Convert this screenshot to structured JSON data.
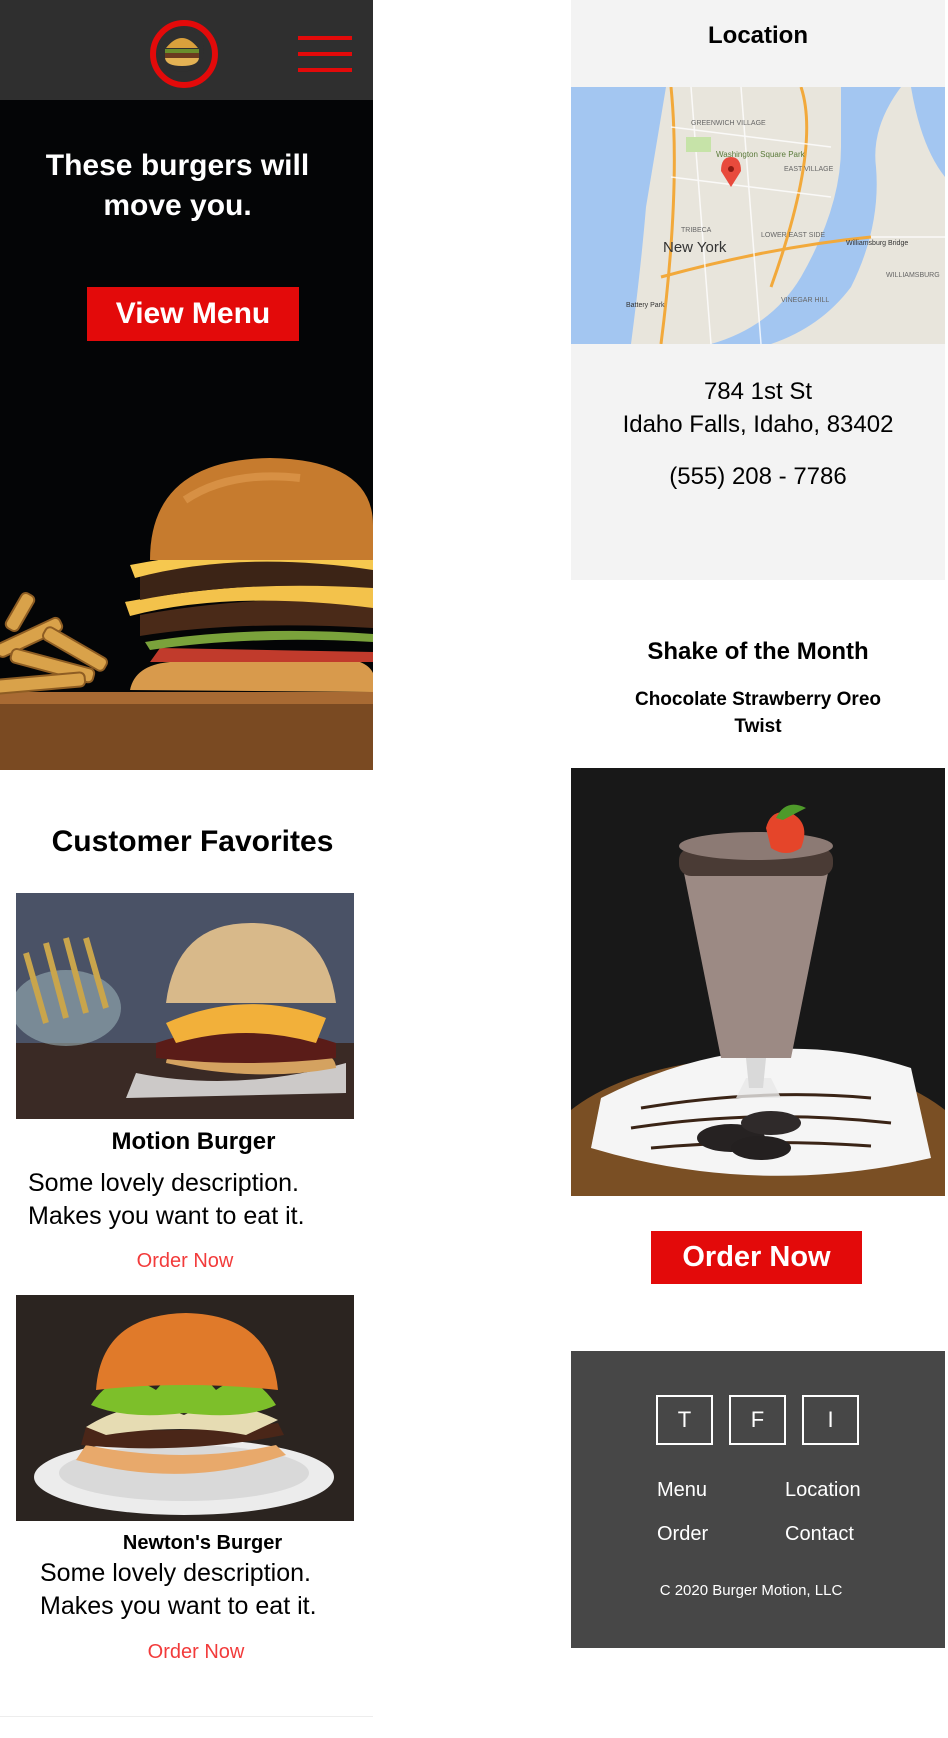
{
  "header": {
    "logo_icon": "burger-logo-icon",
    "menu_icon": "hamburger-menu-icon",
    "accent": "#e30a0a"
  },
  "hero": {
    "title": "These burgers will move you.",
    "cta_label": "View Menu"
  },
  "favorites": {
    "title": "Customer Favorites",
    "items": [
      {
        "name": "Motion Burger",
        "description": "Some lovely description. Makes you want to eat it.",
        "order_label": "Order Now"
      },
      {
        "name": "Newton's Burger",
        "description": "Some lovely description. Makes you want to eat it.",
        "order_label": "Order Now"
      }
    ]
  },
  "location": {
    "title": "Location",
    "map_labels": [
      "Washington Square Park",
      "New York",
      "EAST VILLAGE",
      "TRIBECA",
      "LOWER EAST SIDE",
      "Williamsburg Bridge",
      "WILLIAMSBURG",
      "Battery Park",
      "VINEGAR HILL",
      "GREENWICH VILLAGE"
    ],
    "address_line1": "784 1st St",
    "address_line2": "Idaho Falls, Idaho, 83402",
    "phone": "(555) 208 - 7786"
  },
  "shake": {
    "heading": "Shake of the Month",
    "name": "Chocolate Strawberry Oreo Twist",
    "order_label": "Order Now"
  },
  "footer": {
    "social": [
      "T",
      "F",
      "I"
    ],
    "links": [
      "Menu",
      "Location",
      "Order",
      "Contact"
    ],
    "copyright": "C 2020 Burger Motion, LLC",
    "background": "#474747"
  }
}
